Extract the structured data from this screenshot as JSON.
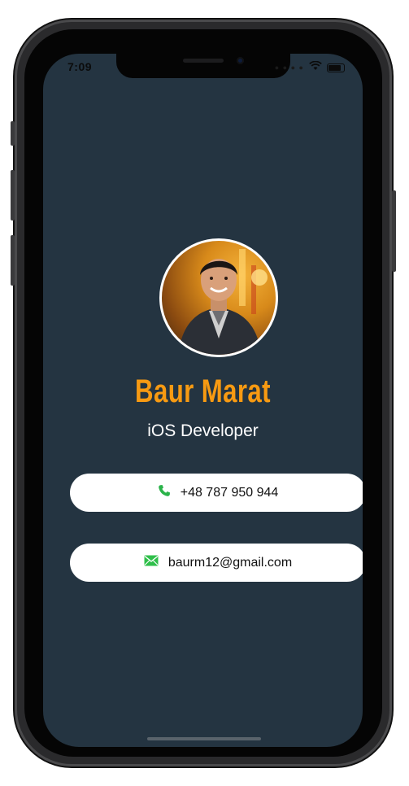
{
  "status_bar": {
    "time": "7:09",
    "signal_icon": "dots-icon",
    "wifi_icon": "wifi-icon",
    "battery_icon": "battery-icon"
  },
  "profile": {
    "avatar_icon": "person-photo",
    "name": "Baur Marat",
    "title": "iOS Developer"
  },
  "contacts": {
    "phone": {
      "icon": "phone-icon",
      "value": "+48 787 950 944"
    },
    "email": {
      "icon": "mail-icon",
      "value": "baurm12@gmail.com"
    }
  },
  "colors": {
    "background": "#243441",
    "name": "#f79a12",
    "phone_icon": "#2bb34a",
    "mail_icon": "#2fbf4a"
  }
}
